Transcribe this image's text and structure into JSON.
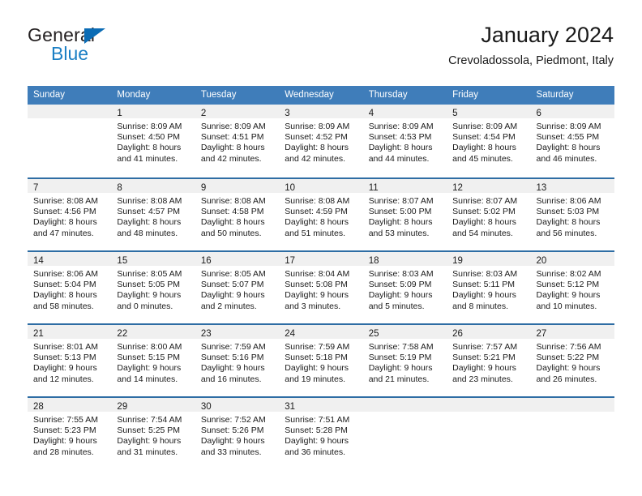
{
  "brand": {
    "name_part1": "General",
    "name_part2": "Blue",
    "triangle_icon": "triangle-icon",
    "accent_color": "#1b7fc4"
  },
  "header": {
    "title": "January 2024",
    "subtitle": "Crevoladossola, Piedmont, Italy"
  },
  "calendar": {
    "header_bg": "#3f7dba",
    "row_divider_color": "#2e6da4",
    "daynum_band_color": "#f0f0f0",
    "weekdays": [
      "Sunday",
      "Monday",
      "Tuesday",
      "Wednesday",
      "Thursday",
      "Friday",
      "Saturday"
    ],
    "weeks": [
      [
        {
          "day": "",
          "lines": []
        },
        {
          "day": "1",
          "lines": [
            "Sunrise: 8:09 AM",
            "Sunset: 4:50 PM",
            "Daylight: 8 hours",
            "and 41 minutes."
          ]
        },
        {
          "day": "2",
          "lines": [
            "Sunrise: 8:09 AM",
            "Sunset: 4:51 PM",
            "Daylight: 8 hours",
            "and 42 minutes."
          ]
        },
        {
          "day": "3",
          "lines": [
            "Sunrise: 8:09 AM",
            "Sunset: 4:52 PM",
            "Daylight: 8 hours",
            "and 42 minutes."
          ]
        },
        {
          "day": "4",
          "lines": [
            "Sunrise: 8:09 AM",
            "Sunset: 4:53 PM",
            "Daylight: 8 hours",
            "and 44 minutes."
          ]
        },
        {
          "day": "5",
          "lines": [
            "Sunrise: 8:09 AM",
            "Sunset: 4:54 PM",
            "Daylight: 8 hours",
            "and 45 minutes."
          ]
        },
        {
          "day": "6",
          "lines": [
            "Sunrise: 8:09 AM",
            "Sunset: 4:55 PM",
            "Daylight: 8 hours",
            "and 46 minutes."
          ]
        }
      ],
      [
        {
          "day": "7",
          "lines": [
            "Sunrise: 8:08 AM",
            "Sunset: 4:56 PM",
            "Daylight: 8 hours",
            "and 47 minutes."
          ]
        },
        {
          "day": "8",
          "lines": [
            "Sunrise: 8:08 AM",
            "Sunset: 4:57 PM",
            "Daylight: 8 hours",
            "and 48 minutes."
          ]
        },
        {
          "day": "9",
          "lines": [
            "Sunrise: 8:08 AM",
            "Sunset: 4:58 PM",
            "Daylight: 8 hours",
            "and 50 minutes."
          ]
        },
        {
          "day": "10",
          "lines": [
            "Sunrise: 8:08 AM",
            "Sunset: 4:59 PM",
            "Daylight: 8 hours",
            "and 51 minutes."
          ]
        },
        {
          "day": "11",
          "lines": [
            "Sunrise: 8:07 AM",
            "Sunset: 5:00 PM",
            "Daylight: 8 hours",
            "and 53 minutes."
          ]
        },
        {
          "day": "12",
          "lines": [
            "Sunrise: 8:07 AM",
            "Sunset: 5:02 PM",
            "Daylight: 8 hours",
            "and 54 minutes."
          ]
        },
        {
          "day": "13",
          "lines": [
            "Sunrise: 8:06 AM",
            "Sunset: 5:03 PM",
            "Daylight: 8 hours",
            "and 56 minutes."
          ]
        }
      ],
      [
        {
          "day": "14",
          "lines": [
            "Sunrise: 8:06 AM",
            "Sunset: 5:04 PM",
            "Daylight: 8 hours",
            "and 58 minutes."
          ]
        },
        {
          "day": "15",
          "lines": [
            "Sunrise: 8:05 AM",
            "Sunset: 5:05 PM",
            "Daylight: 9 hours",
            "and 0 minutes."
          ]
        },
        {
          "day": "16",
          "lines": [
            "Sunrise: 8:05 AM",
            "Sunset: 5:07 PM",
            "Daylight: 9 hours",
            "and 2 minutes."
          ]
        },
        {
          "day": "17",
          "lines": [
            "Sunrise: 8:04 AM",
            "Sunset: 5:08 PM",
            "Daylight: 9 hours",
            "and 3 minutes."
          ]
        },
        {
          "day": "18",
          "lines": [
            "Sunrise: 8:03 AM",
            "Sunset: 5:09 PM",
            "Daylight: 9 hours",
            "and 5 minutes."
          ]
        },
        {
          "day": "19",
          "lines": [
            "Sunrise: 8:03 AM",
            "Sunset: 5:11 PM",
            "Daylight: 9 hours",
            "and 8 minutes."
          ]
        },
        {
          "day": "20",
          "lines": [
            "Sunrise: 8:02 AM",
            "Sunset: 5:12 PM",
            "Daylight: 9 hours",
            "and 10 minutes."
          ]
        }
      ],
      [
        {
          "day": "21",
          "lines": [
            "Sunrise: 8:01 AM",
            "Sunset: 5:13 PM",
            "Daylight: 9 hours",
            "and 12 minutes."
          ]
        },
        {
          "day": "22",
          "lines": [
            "Sunrise: 8:00 AM",
            "Sunset: 5:15 PM",
            "Daylight: 9 hours",
            "and 14 minutes."
          ]
        },
        {
          "day": "23",
          "lines": [
            "Sunrise: 7:59 AM",
            "Sunset: 5:16 PM",
            "Daylight: 9 hours",
            "and 16 minutes."
          ]
        },
        {
          "day": "24",
          "lines": [
            "Sunrise: 7:59 AM",
            "Sunset: 5:18 PM",
            "Daylight: 9 hours",
            "and 19 minutes."
          ]
        },
        {
          "day": "25",
          "lines": [
            "Sunrise: 7:58 AM",
            "Sunset: 5:19 PM",
            "Daylight: 9 hours",
            "and 21 minutes."
          ]
        },
        {
          "day": "26",
          "lines": [
            "Sunrise: 7:57 AM",
            "Sunset: 5:21 PM",
            "Daylight: 9 hours",
            "and 23 minutes."
          ]
        },
        {
          "day": "27",
          "lines": [
            "Sunrise: 7:56 AM",
            "Sunset: 5:22 PM",
            "Daylight: 9 hours",
            "and 26 minutes."
          ]
        }
      ],
      [
        {
          "day": "28",
          "lines": [
            "Sunrise: 7:55 AM",
            "Sunset: 5:23 PM",
            "Daylight: 9 hours",
            "and 28 minutes."
          ]
        },
        {
          "day": "29",
          "lines": [
            "Sunrise: 7:54 AM",
            "Sunset: 5:25 PM",
            "Daylight: 9 hours",
            "and 31 minutes."
          ]
        },
        {
          "day": "30",
          "lines": [
            "Sunrise: 7:52 AM",
            "Sunset: 5:26 PM",
            "Daylight: 9 hours",
            "and 33 minutes."
          ]
        },
        {
          "day": "31",
          "lines": [
            "Sunrise: 7:51 AM",
            "Sunset: 5:28 PM",
            "Daylight: 9 hours",
            "and 36 minutes."
          ]
        },
        {
          "day": "",
          "lines": []
        },
        {
          "day": "",
          "lines": []
        },
        {
          "day": "",
          "lines": []
        }
      ]
    ]
  }
}
